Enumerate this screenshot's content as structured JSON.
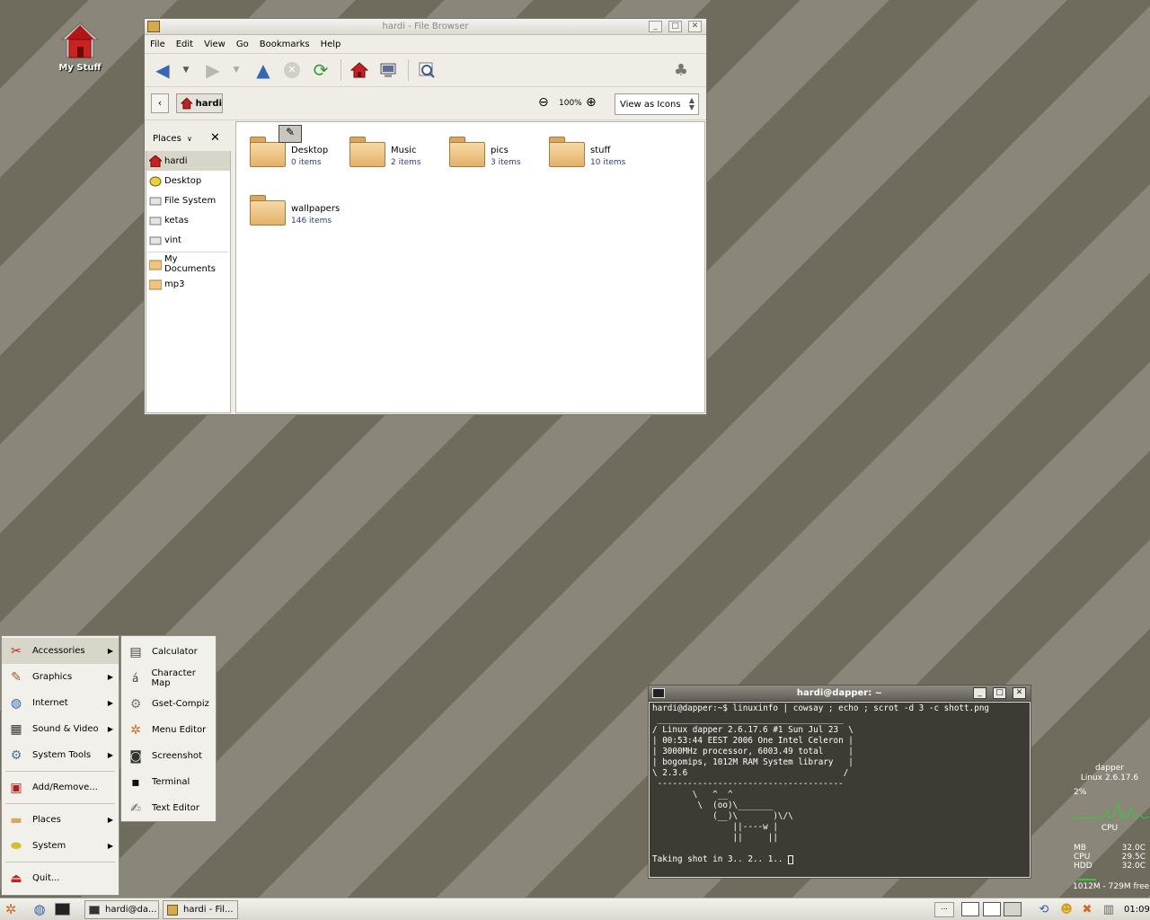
{
  "desktop": {
    "icon_label": "My Stuff"
  },
  "file_browser": {
    "title": "hardi - File Browser",
    "menu": [
      "File",
      "Edit",
      "View",
      "Go",
      "Bookmarks",
      "Help"
    ],
    "location": "hardi",
    "zoom": "100%",
    "view_mode": "View as Icons",
    "sidebar_title": "Places",
    "places": [
      {
        "label": "hardi",
        "icon": "home-icon"
      },
      {
        "label": "Desktop",
        "icon": "desktop-icon"
      },
      {
        "label": "File System",
        "icon": "drive-icon"
      },
      {
        "label": "ketas",
        "icon": "drive-icon"
      },
      {
        "label": "vint",
        "icon": "drive-icon"
      }
    ],
    "bookmarks": [
      {
        "label": "My Documents",
        "icon": "folder-icon"
      },
      {
        "label": "mp3",
        "icon": "folder-icon"
      }
    ],
    "items": [
      {
        "name": "Desktop",
        "count": "0 items"
      },
      {
        "name": "Music",
        "count": "2 items"
      },
      {
        "name": "pics",
        "count": "3 items"
      },
      {
        "name": "stuff",
        "count": "10 items"
      },
      {
        "name": "wallpapers",
        "count": "146 items"
      }
    ]
  },
  "terminal": {
    "title": "hardi@dapper: ~",
    "lines": [
      "hardi@dapper:~$ linuxinfo | cowsay ; echo ; scrot -d 3 -c shott.png",
      " _____________________________________",
      "/ Linux dapper 2.6.17.6 #1 Sun Jul 23  \\",
      "| 00:53:44 EEST 2006 One Intel Celeron |",
      "| 3000MHz processor, 6003.49 total     |",
      "| bogomips, 1012M RAM System library   |",
      "\\ 2.3.6                               /",
      " -------------------------------------",
      "        \\   ^__^",
      "         \\  (oo)\\_______",
      "            (__)\\       )\\/\\",
      "                ||----w |",
      "                ||     ||",
      "",
      "Taking shot in 3.. 2.. 1.. "
    ]
  },
  "app_menu": {
    "items": [
      {
        "label": "Accessories",
        "icon": "accessories-icon",
        "submenu": true
      },
      {
        "label": "Graphics",
        "icon": "brush-icon",
        "submenu": true
      },
      {
        "label": "Internet",
        "icon": "globe-icon",
        "submenu": true
      },
      {
        "label": "Sound & Video",
        "icon": "film-icon",
        "submenu": true
      },
      {
        "label": "System Tools",
        "icon": "gear-icon",
        "submenu": true
      },
      {
        "label": "Add/Remove...",
        "icon": "package-icon",
        "submenu": false
      },
      {
        "label": "Places",
        "icon": "folder-icon",
        "submenu": true
      },
      {
        "label": "System",
        "icon": "system-icon",
        "submenu": true
      },
      {
        "label": "Quit...",
        "icon": "quit-icon",
        "submenu": false
      }
    ],
    "accessories": [
      {
        "label": "Calculator",
        "icon": "calculator-icon"
      },
      {
        "label": "Character Map",
        "icon": "charmap-icon"
      },
      {
        "label": "Gset-Compiz",
        "icon": "gear-icon"
      },
      {
        "label": "Menu Editor",
        "icon": "menu-editor-icon"
      },
      {
        "label": "Screenshot",
        "icon": "camera-icon"
      },
      {
        "label": "Terminal",
        "icon": "terminal-icon"
      },
      {
        "label": "Text Editor",
        "icon": "text-editor-icon"
      }
    ]
  },
  "panel": {
    "tasks": [
      "hardi@da...",
      "hardi - Fil..."
    ],
    "clock": "01:09"
  },
  "conky": {
    "host": "dapper",
    "kernel": "Linux 2.6.17.6",
    "cpu_pct": "2%",
    "cpu_label": "CPU",
    "temps": [
      {
        "label": "MB",
        "value": "32.0C"
      },
      {
        "label": "CPU",
        "value": "29.5C"
      },
      {
        "label": "HDD",
        "value": "32.0C"
      }
    ],
    "mem": "1012M - 729M free"
  },
  "colors": {
    "desktop_stripe_a": "#6f6c5e",
    "desktop_stripe_b": "#8a877a",
    "link_blue": "#2c3d86",
    "terminal_bg": "#3d3c34"
  }
}
